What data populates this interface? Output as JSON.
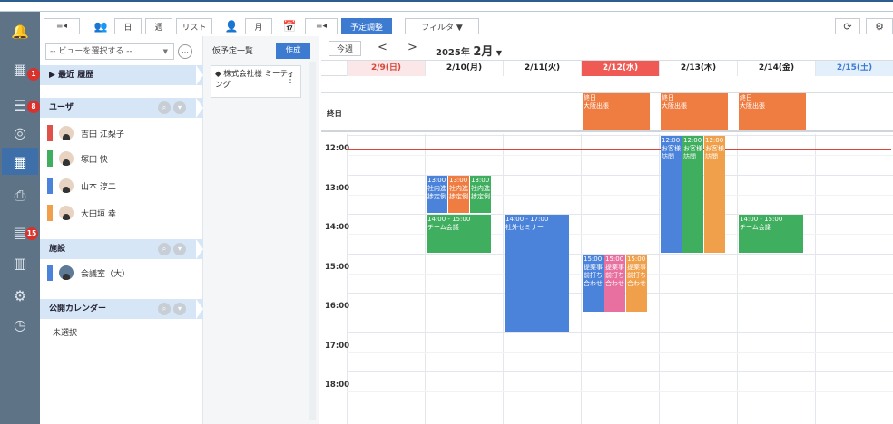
{
  "toolbar": {
    "day": "日",
    "week": "週",
    "list": "リスト",
    "month": "月",
    "adjust": "予定調整",
    "filter": "フィルタ ▼"
  },
  "sidebar": {
    "view_select": "-- ビューを選択する --",
    "history": "▶ 最近 履歴",
    "users_header": "ユーザ",
    "users": [
      {
        "name": "吉田 江梨子",
        "color": "#e0514a"
      },
      {
        "name": "塚田 快",
        "color": "#3fae5e"
      },
      {
        "name": "山本 淳二",
        "color": "#4b83da"
      },
      {
        "name": "大田垣 幸",
        "color": "#f0a04b"
      }
    ],
    "facilities_header": "施設",
    "facilities": [
      {
        "name": "会議室（大）",
        "color": "#4b83da"
      }
    ],
    "public_header": "公開カレンダー",
    "public_value": "未選択",
    "badges": [
      "1",
      "8",
      "15"
    ]
  },
  "tentative": {
    "title": "仮予定一覧",
    "create": "作成",
    "card_text": "株式会社様 ミーティング"
  },
  "calendar": {
    "this_week": "今週",
    "prev": "<",
    "next": ">",
    "year": "2025年",
    "month": "2月",
    "month_caret": "▼",
    "allday_label": "終日",
    "days": [
      {
        "label": "2/9(日)",
        "bg": "#fbe7e7",
        "color": "#d9463c"
      },
      {
        "label": "2/10(月)",
        "bg": "#ffffff",
        "color": "#222"
      },
      {
        "label": "2/11(火)",
        "bg": "#ffffff",
        "color": "#222"
      },
      {
        "label": "2/12(水)",
        "bg": "#ef5b54",
        "color": "#ffffff"
      },
      {
        "label": "2/13(木)",
        "bg": "#ffffff",
        "color": "#222"
      },
      {
        "label": "2/14(金)",
        "bg": "#ffffff",
        "color": "#222"
      },
      {
        "label": "2/15(土)",
        "bg": "#e3f0fb",
        "color": "#3d7bd0"
      }
    ],
    "hours": [
      "12:00",
      "13:00",
      "14:00",
      "15:00",
      "16:00",
      "17:00",
      "18:00"
    ],
    "allday_events": [
      {
        "day": 3,
        "text": "終日\n大阪出張"
      },
      {
        "day": 4,
        "text": "終日\n大阪出張"
      },
      {
        "day": 5,
        "text": "終日\n大阪出張"
      }
    ],
    "events": [
      {
        "day": 1,
        "sub": 0,
        "subs": 3,
        "start": 13.0,
        "end": 14.0,
        "color": "#4b83da",
        "text": "13:00\n社内進捗定例"
      },
      {
        "day": 1,
        "sub": 1,
        "subs": 3,
        "start": 13.0,
        "end": 14.0,
        "color": "#ef7d42",
        "text": "13:00\n社内進捗定例"
      },
      {
        "day": 1,
        "sub": 2,
        "subs": 3,
        "start": 13.0,
        "end": 14.0,
        "color": "#3fae5e",
        "text": "13:00\n社内進捗定例"
      },
      {
        "day": 1,
        "sub": 0,
        "subs": 1,
        "start": 14.0,
        "end": 15.0,
        "color": "#3fae5e",
        "text": "14:00 - 15:00\nチーム会議"
      },
      {
        "day": 2,
        "sub": 0,
        "subs": 1,
        "start": 14.0,
        "end": 17.0,
        "color": "#4b83da",
        "text": "14:00 - 17:00\n社外セミナー"
      },
      {
        "day": 3,
        "sub": 0,
        "subs": 3,
        "start": 15.0,
        "end": 16.5,
        "color": "#4b83da",
        "text": "15:00\n提案事前打ち合わせ"
      },
      {
        "day": 3,
        "sub": 1,
        "subs": 3,
        "start": 15.0,
        "end": 16.5,
        "color": "#e870a0",
        "text": "15:00\n提案事前打ち合わせ"
      },
      {
        "day": 3,
        "sub": 2,
        "subs": 3,
        "start": 15.0,
        "end": 16.5,
        "color": "#f0a04b",
        "text": "15:00\n提案事前打ち合わせ"
      },
      {
        "day": 4,
        "sub": 0,
        "subs": 3,
        "start": 12.0,
        "end": 15.0,
        "color": "#4b83da",
        "text": "12:00\nお客様訪問"
      },
      {
        "day": 4,
        "sub": 1,
        "subs": 3,
        "start": 12.0,
        "end": 15.0,
        "color": "#3fae5e",
        "text": "12:00\nお客様訪問"
      },
      {
        "day": 4,
        "sub": 2,
        "subs": 3,
        "start": 12.0,
        "end": 15.0,
        "color": "#f0a04b",
        "text": "12:00\nお客様訪問"
      },
      {
        "day": 5,
        "sub": 0,
        "subs": 1,
        "start": 14.0,
        "end": 15.0,
        "color": "#3fae5e",
        "text": "14:00 - 15:00\nチーム会議"
      }
    ],
    "allday_color": "#ef7d42"
  }
}
